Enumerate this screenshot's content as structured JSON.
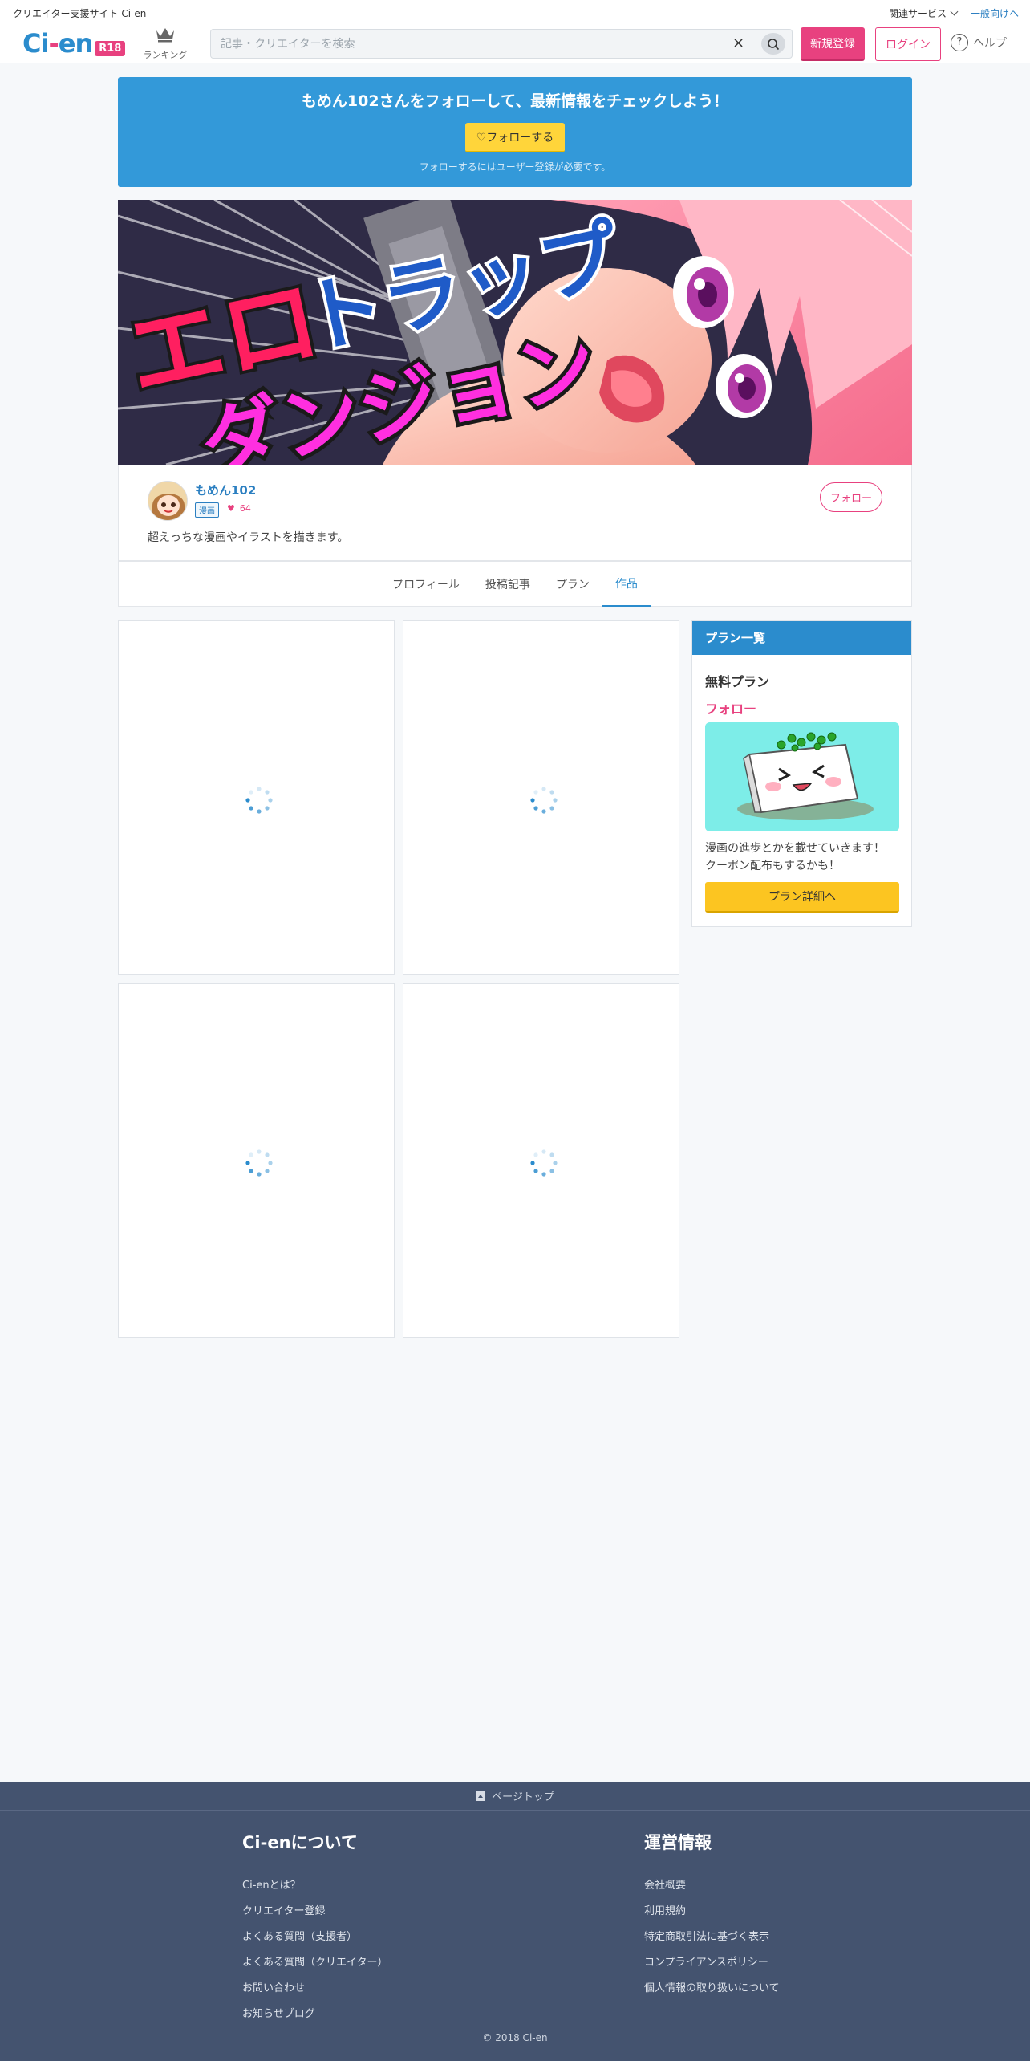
{
  "header": {
    "site_tag": "クリエイター支援サイト Ci-en",
    "related_services": "関連サービス",
    "general_link": "一般向けへ",
    "logo_text_1": "Ci",
    "logo_dot": "-",
    "logo_text_2": "en",
    "logo_badge": "R18",
    "ranking_label": "ランキング",
    "search_placeholder": "記事・クリエイターを検索",
    "clear_symbol": "×",
    "register_label": "新規登録",
    "login_label": "ログイン",
    "help_label": "ヘルプ",
    "help_symbol": "?"
  },
  "follow_banner": {
    "title": "もめん102さんをフォローして、最新情報をチェックしよう！",
    "button_label": "♡フォローする",
    "note": "フォローするにはユーザー登録が必要です。"
  },
  "hero": {
    "line1_a": "エロ",
    "line1_b": "トラップ",
    "line2": "ダンジョン"
  },
  "creator": {
    "name": "もめん102",
    "genre": "漫画",
    "fav_count": "64",
    "fav_symbol": "♥",
    "description": "超えっちな漫画やイラストを描きます。",
    "follow_label": "フォロー"
  },
  "tabs": [
    {
      "label": "プロフィール",
      "active": false
    },
    {
      "label": "投稿記事",
      "active": false
    },
    {
      "label": "プラン",
      "active": false
    },
    {
      "label": "作品",
      "active": true
    }
  ],
  "plans": {
    "heading": "プラン一覧",
    "plan_name": "無料プラン",
    "plan_price": "フォロー",
    "description_line1": "漫画の進歩とかを載せていきます！",
    "description_line2": "クーポン配布もするかも！",
    "detail_button": "プラン詳細へ"
  },
  "footer": {
    "page_top": "ページトップ",
    "about_heading": "Ci-enについて",
    "about_links": [
      "Ci-enとは？",
      "クリエイター登録",
      "よくある質問（支援者）",
      "よくある質問（クリエイター）",
      "お問い合わせ",
      "お知らせブログ"
    ],
    "ops_heading": "運営情報",
    "ops_links": [
      "会社概要",
      "利用規約",
      "特定商取引法に基づく表示",
      "コンプライアンスポリシー",
      "個人情報の取り扱いについて"
    ],
    "copyright": "© 2018 Ci-en"
  },
  "colors": {
    "brand_blue": "#2b8ccd",
    "brand_pink": "#e8417f",
    "banner_blue": "#3399d9",
    "button_yellow": "#fcc521",
    "footer_bg": "#44536f"
  }
}
